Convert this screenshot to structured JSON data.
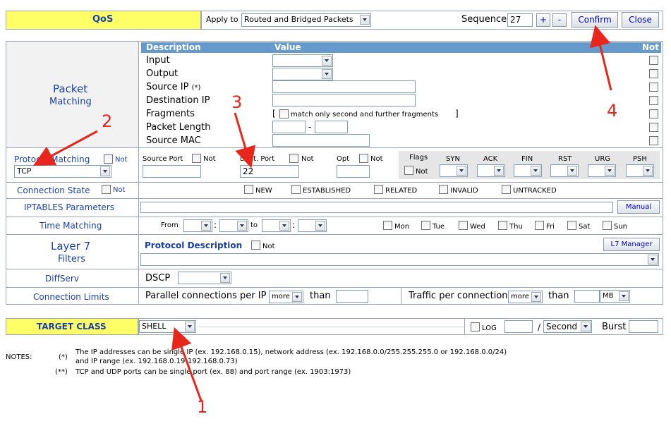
{
  "header": {
    "title": "QoS",
    "apply_label": "Apply to",
    "apply_value": "Routed and Bridged Packets",
    "sequence_label": "Sequence",
    "sequence_value": "27",
    "plus": "+",
    "minus": "-",
    "confirm": "Confirm",
    "close": "Close"
  },
  "packet_matching": {
    "title": "Packet",
    "title2": "Matching",
    "col_description": "Description",
    "col_value": "Value",
    "col_not": "Not",
    "rows": [
      "Input",
      "Output",
      "Source IP",
      "Destination IP",
      "Fragments",
      "Packet Length",
      "Source MAC"
    ],
    "source_ip_suffix": "(*)",
    "fragments_text": "match only second and further fragments",
    "bracket_open": "[",
    "bracket_close": "]",
    "length_sep": "-"
  },
  "protocol": {
    "label": "Protocol Matching",
    "not": "Not",
    "value": "TCP",
    "source_port": "Source Port",
    "dest_port": "Dest. Port",
    "dest_port_value": "22",
    "opt": "Opt",
    "flags": "Flags",
    "flag_names": [
      "SYN",
      "ACK",
      "FIN",
      "RST",
      "URG",
      "PSH"
    ]
  },
  "connection_state": {
    "label": "Connection State",
    "not": "Not",
    "states": [
      "NEW",
      "ESTABLISHED",
      "RELATED",
      "INVALID",
      "UNTRACKED"
    ]
  },
  "iptables": {
    "label": "IPTABLES Parameters",
    "manual": "Manual"
  },
  "time": {
    "label": "Time Matching",
    "from": "From",
    "to": "to",
    "colon": ":",
    "days": [
      "Mon",
      "Tue",
      "Wed",
      "Thu",
      "Fri",
      "Sat",
      "Sun"
    ]
  },
  "layer7": {
    "title": "Layer 7",
    "title2": "Filters",
    "protocol_description": "Protocol Description",
    "not": "Not",
    "manager": "L7 Manager"
  },
  "diffserv": {
    "label": "DiffServ",
    "dscp": "DSCP"
  },
  "limits": {
    "label": "Connection Limits",
    "parallel": "Parallel connections per IP",
    "more": "more",
    "than": "than",
    "traffic": "Traffic per connection",
    "unit": "MB"
  },
  "target": {
    "label": "TARGET CLASS",
    "value": "SHELL",
    "log": "LOG",
    "slash": "/",
    "period": "Second",
    "burst": "Burst"
  },
  "notes": {
    "label": "NOTES:",
    "mark1": "(*)",
    "line1": "The IP addresses can be single IP (ex. 192.168.0.15), network address (ex. 192.168.0.0/255.255.255.0 or 192.168.0.0/24)",
    "line1b": "and IP range (ex. 192.168.0.19-192.168.0.73)",
    "mark2": "(**)",
    "line2": "TCP and UDP ports can be single port (ex. 88) and port range (ex. 1903:1973)"
  },
  "annotations": [
    "1",
    "2",
    "3",
    "4"
  ],
  "colors": {
    "accent_yellow": "#ffff66",
    "header_blue": "#6699cc",
    "annotation_red": "#e8261c"
  }
}
